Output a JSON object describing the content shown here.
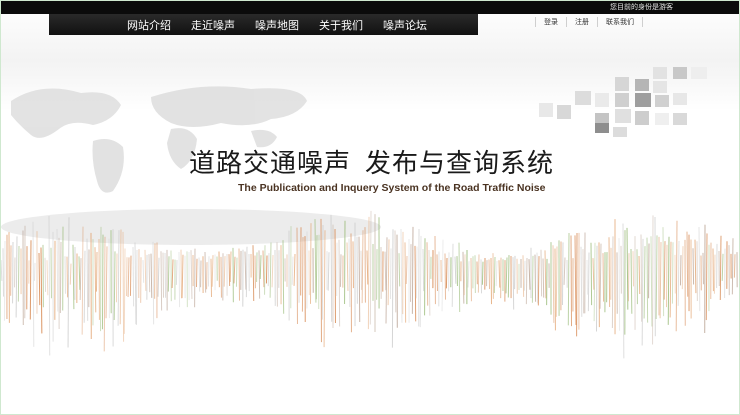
{
  "header": {
    "identity_text": "您目前的身份是游客"
  },
  "nav": {
    "items": [
      {
        "label": "网站介绍"
      },
      {
        "label": "走近噪声"
      },
      {
        "label": "噪声地图"
      },
      {
        "label": "关于我们"
      },
      {
        "label": "噪声论坛"
      }
    ]
  },
  "user_links": {
    "login": "登录",
    "register": "注册",
    "contact": "联系我们"
  },
  "banner": {
    "title_cn_part1": "道路交通噪声",
    "title_cn_part2": "发布与查询系统",
    "title_en": "The Publication and Inquery System of the Road Traffic Noise"
  },
  "colors": {
    "topbar": "#0b0b0b",
    "nav_bg": "#1c1c1c",
    "accent_orange": "#d27a3c",
    "accent_green": "#8fb46a"
  }
}
